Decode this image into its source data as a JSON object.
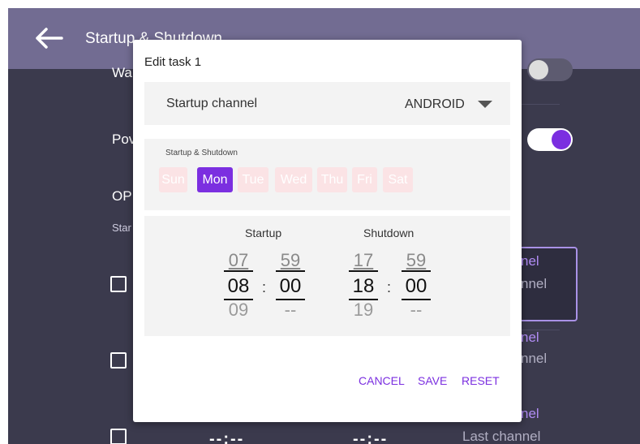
{
  "appbar": {
    "title": "Startup & Shutdown"
  },
  "background": {
    "row1_label": "Wa",
    "row2_label": "Pov",
    "section_label": "OP",
    "section_sub": "Star",
    "channel_rows": [
      {
        "line1": "nel",
        "line2": "nnel"
      },
      {
        "line1": "nel",
        "line2": "nnel"
      },
      {
        "line1": "nel",
        "line2": "Last channel"
      }
    ],
    "time_placeholder": "--:--"
  },
  "dialog": {
    "title": "Edit task 1",
    "channel": {
      "label": "Startup channel",
      "value": "ANDROID"
    },
    "days": {
      "title": "Startup & Shutdown",
      "items": [
        {
          "label": "Sun",
          "selected": false
        },
        {
          "label": "Mon",
          "selected": true
        },
        {
          "label": "Tue",
          "selected": false
        },
        {
          "label": "Wed",
          "selected": false
        },
        {
          "label": "Thu",
          "selected": false
        },
        {
          "label": "Fri",
          "selected": false
        },
        {
          "label": "Sat",
          "selected": false
        }
      ]
    },
    "startup": {
      "label": "Startup",
      "hour": {
        "prev": "07",
        "current": "08",
        "next": "09"
      },
      "minute": {
        "prev": "59",
        "current": "00",
        "next": "--"
      }
    },
    "shutdown": {
      "label": "Shutdown",
      "hour": {
        "prev": "17",
        "current": "18",
        "next": "19"
      },
      "minute": {
        "prev": "59",
        "current": "00",
        "next": "--"
      }
    },
    "separator": ":",
    "actions": {
      "cancel": "CANCEL",
      "save": "SAVE",
      "reset": "RESET"
    }
  },
  "colors": {
    "accent": "#7b2fe0",
    "appbar": "#726c92",
    "background": "#3b3a4d"
  }
}
